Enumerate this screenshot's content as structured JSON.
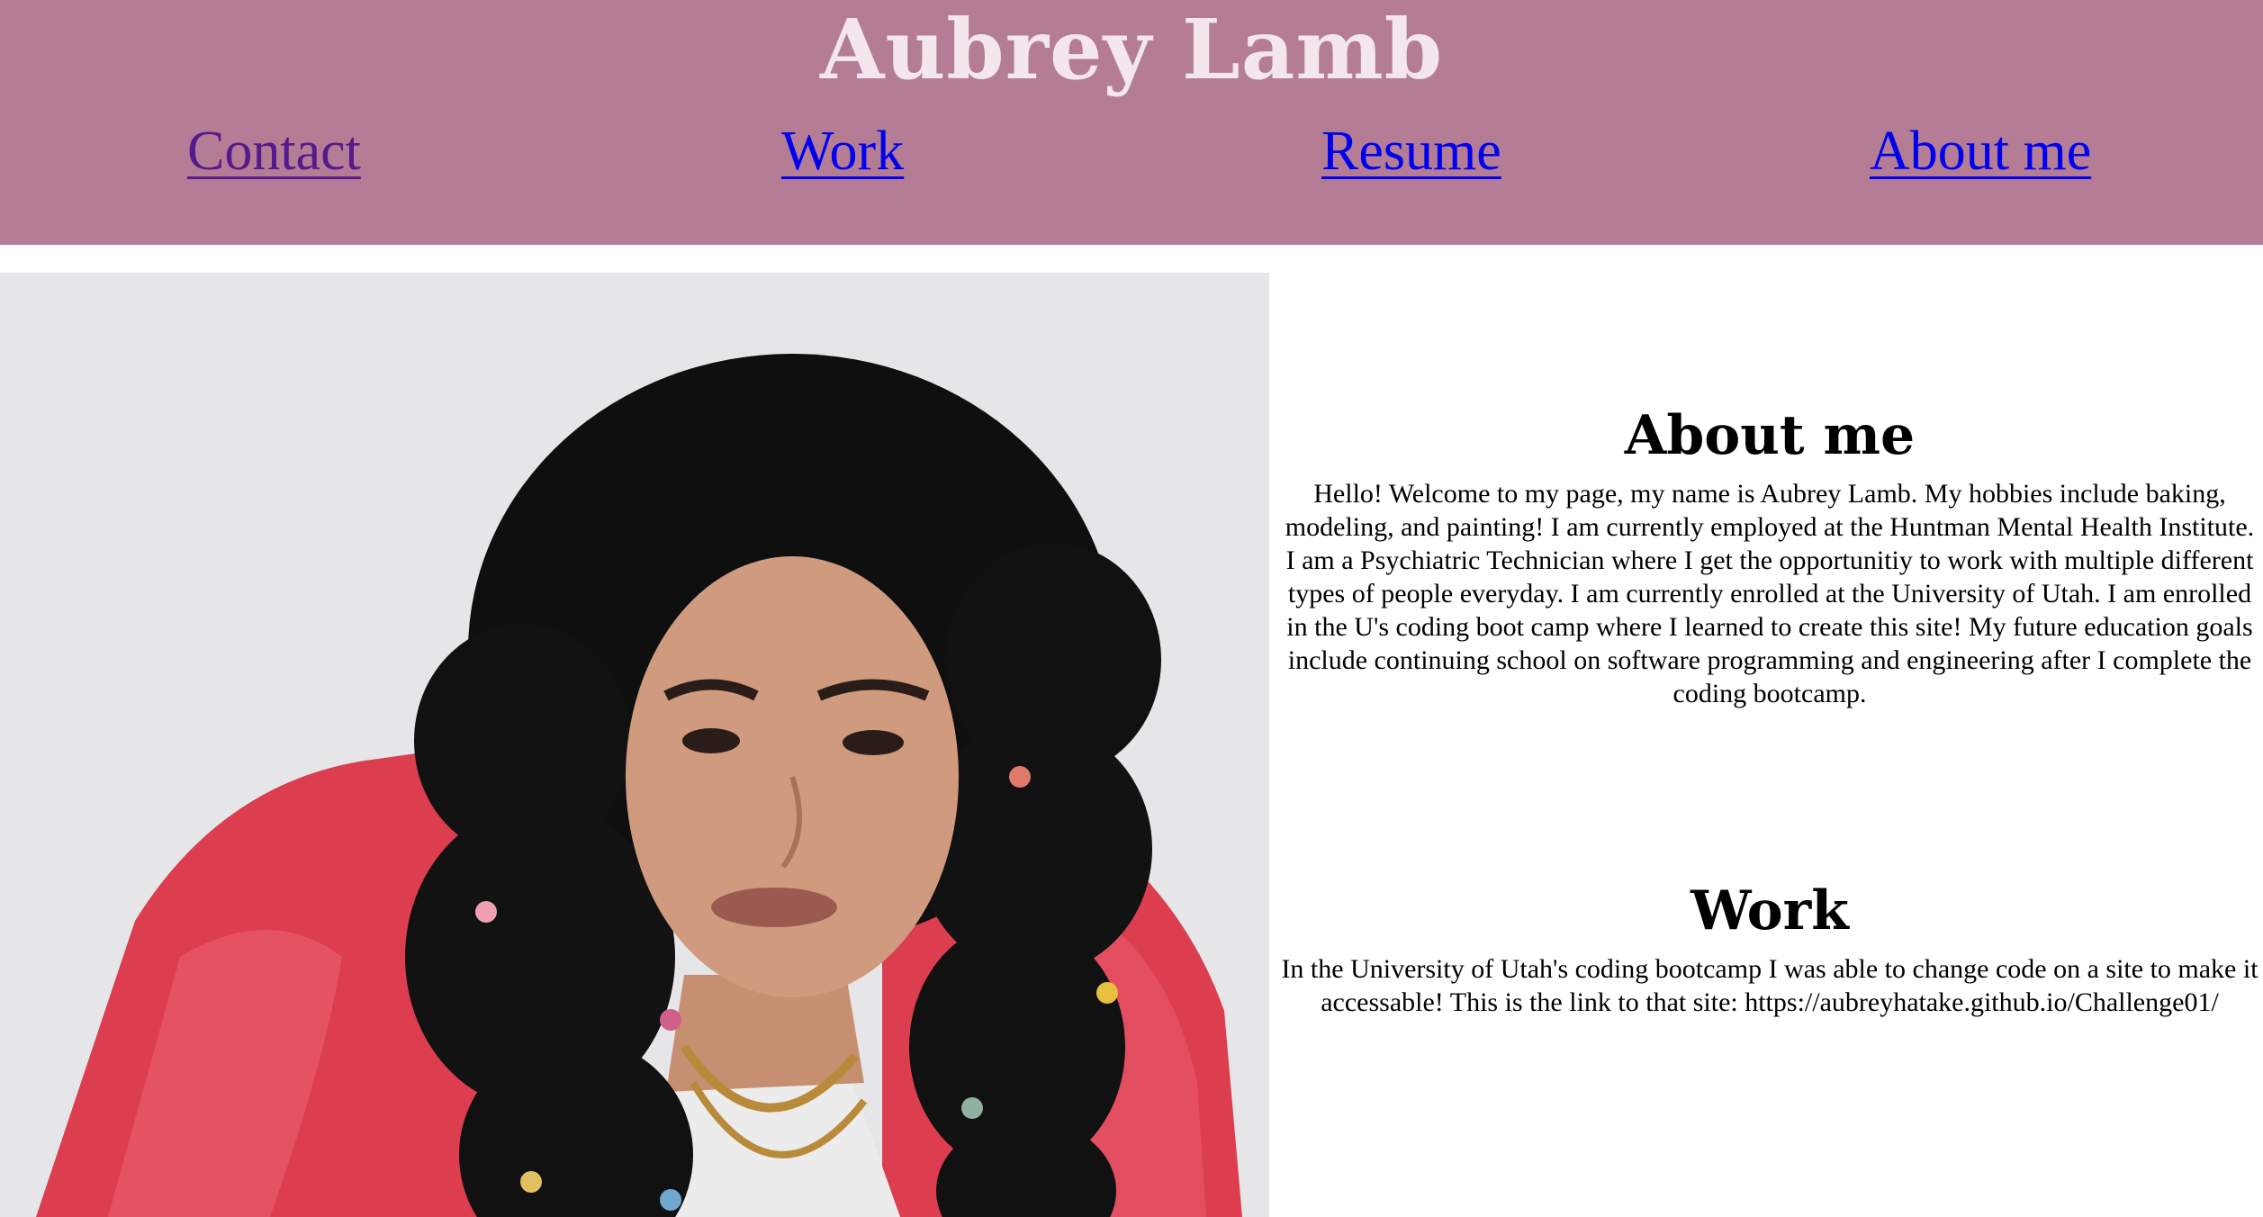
{
  "header": {
    "title": "Aubrey Lamb",
    "background_color": "#b47d95"
  },
  "nav": {
    "contact": "Contact",
    "work": "Work",
    "resume": "Resume",
    "about": "About me"
  },
  "portrait": {
    "icon": "portrait-photo"
  },
  "about": {
    "heading": "About me",
    "body": "Hello! Welcome to my page, my name is Aubrey Lamb. My hobbies include baking, modeling, and painting! I am currently employed at the Huntman Mental Health Institute. I am a Psychiatric Technician where I get the opportunitiy to work with multiple different types of people everyday. I am currently enrolled at the University of Utah. I am enrolled in the U's coding boot camp where I learned to create this site! My future education goals include continuing school on software programming and engineering after I complete the coding bootcamp."
  },
  "work": {
    "heading": "Work",
    "body": "In the University of Utah's coding bootcamp I was able to change code on a site to make it accessable! This is the link to that site: https://aubreyhatake.github.io/Challenge01/"
  }
}
